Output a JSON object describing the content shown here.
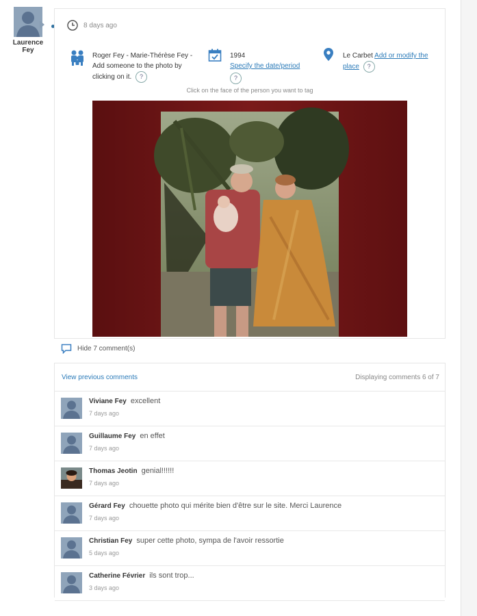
{
  "author": {
    "name": "Laurence Fey"
  },
  "post": {
    "time": "8 days ago",
    "people": "Roger Fey - Marie-Thérèse Fey - Add someone to the photo by clicking on it.",
    "date": "1994",
    "date_link": "Specify the date/period",
    "place": "Le Carbet",
    "place_link": "Add or modify the place",
    "hint": "Click on the face of the person you want to tag"
  },
  "comments_toggle": "Hide 7 comment(s)",
  "comments_header": {
    "view_previous": "View previous comments",
    "displaying": "Displaying comments 6 of 7"
  },
  "comments": [
    {
      "name": "Viviane Fey",
      "text": "excellent",
      "time": "7 days ago"
    },
    {
      "name": "Guillaume Fey",
      "text": "en effet",
      "time": "7 days ago"
    },
    {
      "name": "Thomas Jeotin",
      "text": "genial!!!!!!",
      "time": "7 days ago"
    },
    {
      "name": "Gérard Fey",
      "text": "chouette photo qui mérite bien d'être sur le site. Merci Laurence",
      "time": "7 days ago"
    },
    {
      "name": "Christian Fey",
      "text": "super cette photo, sympa de l'avoir ressortie",
      "time": "5 days ago"
    },
    {
      "name": "Catherine Février",
      "text": "ils sont trop...",
      "time": "3 days ago"
    }
  ]
}
